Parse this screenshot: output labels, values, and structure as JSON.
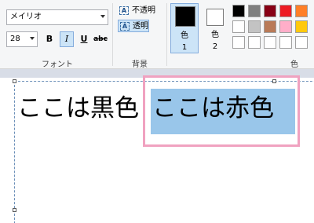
{
  "ribbon": {
    "font_group": {
      "font_family": "メイリオ",
      "font_size": "28",
      "bold_label": "B",
      "italic_label": "I",
      "underline_label": "U",
      "strike_label": "abc",
      "label": "フォント"
    },
    "background_group": {
      "opaque_label": "不透明",
      "transparent_label": "透明",
      "label": "背景"
    },
    "colors_group": {
      "color1_label": "色",
      "color1_num": "1",
      "color1_value": "#000000",
      "color2_label": "色",
      "color2_num": "2",
      "color2_value": "#ffffff",
      "label": "色",
      "palette": [
        "#000000",
        "#7f7f7f",
        "#880015",
        "#ed1c24",
        "#ff7f27",
        "#ffffff",
        "#c3c3c3",
        "#b97a57",
        "#ffaec9",
        "#ffc90e",
        "#ffffff",
        "#ffffff",
        "#ffffff",
        "#ffffff",
        "#ffffff"
      ]
    }
  },
  "canvas": {
    "text_black": "ここは黒色",
    "text_red": "ここは赤色",
    "highlight_color": "#99c6ea",
    "annotation_color": "#f0a2c0"
  }
}
